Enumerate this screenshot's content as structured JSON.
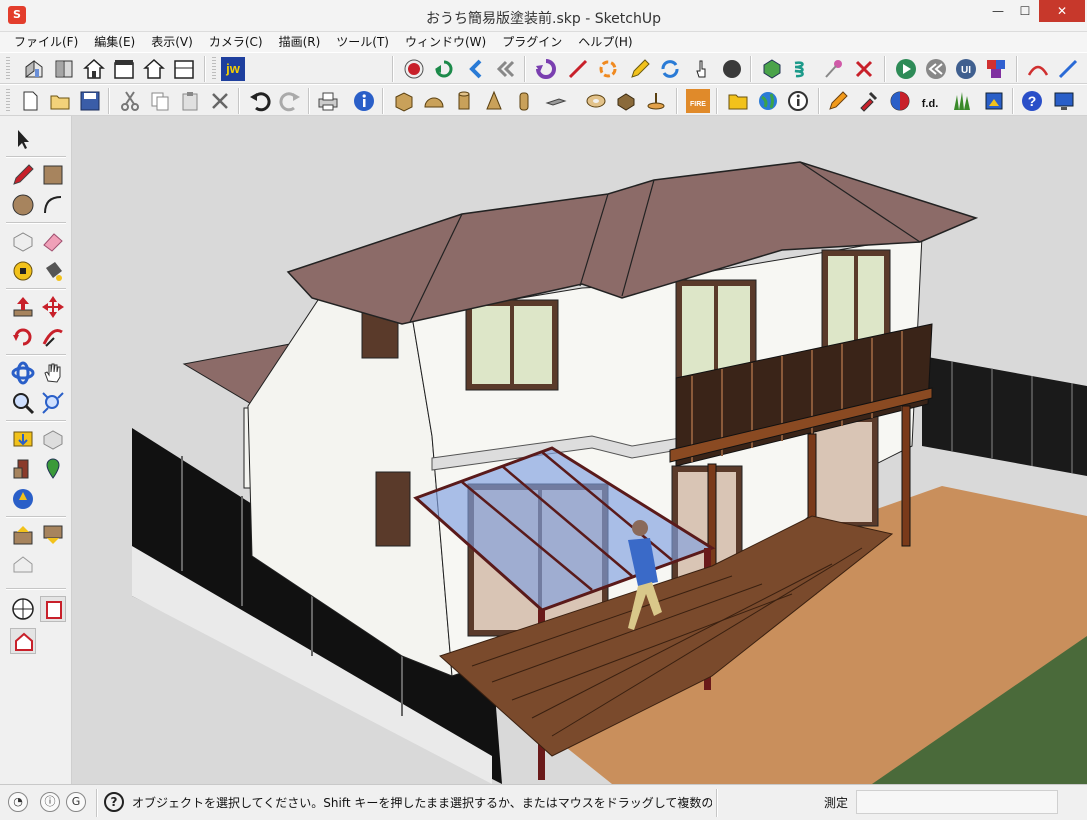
{
  "window": {
    "title": "おうち簡易版塗装前.skp - SketchUp",
    "app_icon": "sketchup-logo",
    "controls": {
      "minimize": "—",
      "maximize": "☐",
      "close": "✕"
    }
  },
  "menu": [
    "ファイル(F)",
    "編集(E)",
    "表示(V)",
    "カメラ(C)",
    "描画(R)",
    "ツール(T)",
    "ウィンドウ(W)",
    "プラグイン",
    "ヘルプ(H)"
  ],
  "toolbar": {
    "jw_label": "jw",
    "fire_label": "FIRE",
    "fd_label": "f.d."
  },
  "status": {
    "icons": [
      "geo-location-icon",
      "credits-icon",
      "google-signin-icon"
    ],
    "message": "オブジェクトを選択してください。Shift キーを押したまま選択するか、またはマウスをドラッグして複数のオブジェクトを選",
    "measure_label": "測定",
    "measure_value": ""
  },
  "colors": {
    "roof": "#8c6b68",
    "wall": "#f4f4f0",
    "deck": "#7a4a2c",
    "ground": "#c98f5c",
    "fence": "#1a1a1a",
    "glass": "#7fa0e0",
    "close_button": "#c7382b"
  }
}
